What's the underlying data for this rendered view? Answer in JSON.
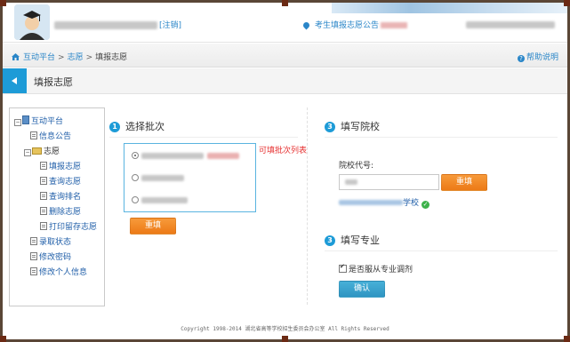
{
  "header": {
    "logout_label": "[注销]",
    "notice_label": "考生填报志愿公告",
    "avatar_icon": "student-graduate-avatar-icon",
    "accent_color": "#1d9bd7"
  },
  "breadcrumb": {
    "home_icon": "home-icon",
    "items": [
      "互动平台",
      "志愿",
      "填报志愿"
    ],
    "separator": ">"
  },
  "help_label": "帮助说明",
  "page_title": "填报志愿",
  "tree": {
    "root": "互动平台",
    "info": "信息公告",
    "group": "志愿",
    "children": [
      "填报志愿",
      "查询志愿",
      "查询排名",
      "删除志愿",
      "打印留存志愿"
    ],
    "after": [
      "录取状态",
      "修改密码",
      "修改个人信息"
    ]
  },
  "section1": {
    "number": "1",
    "title": "选择批次",
    "hint": "可填批次列表",
    "button": "重填"
  },
  "section3a": {
    "number": "3",
    "title": "填写院校",
    "code_label": "院校代号:",
    "button": "重填",
    "school_suffix": "学校"
  },
  "section3b": {
    "number": "3",
    "title": "填写专业",
    "adjust_label": "是否服从专业调剂",
    "adjust_checked": true,
    "confirm": "确认"
  },
  "footer": "Copyright 1998-2014 湖北省高等学校招生委员会办公室 All Rights Reserved"
}
